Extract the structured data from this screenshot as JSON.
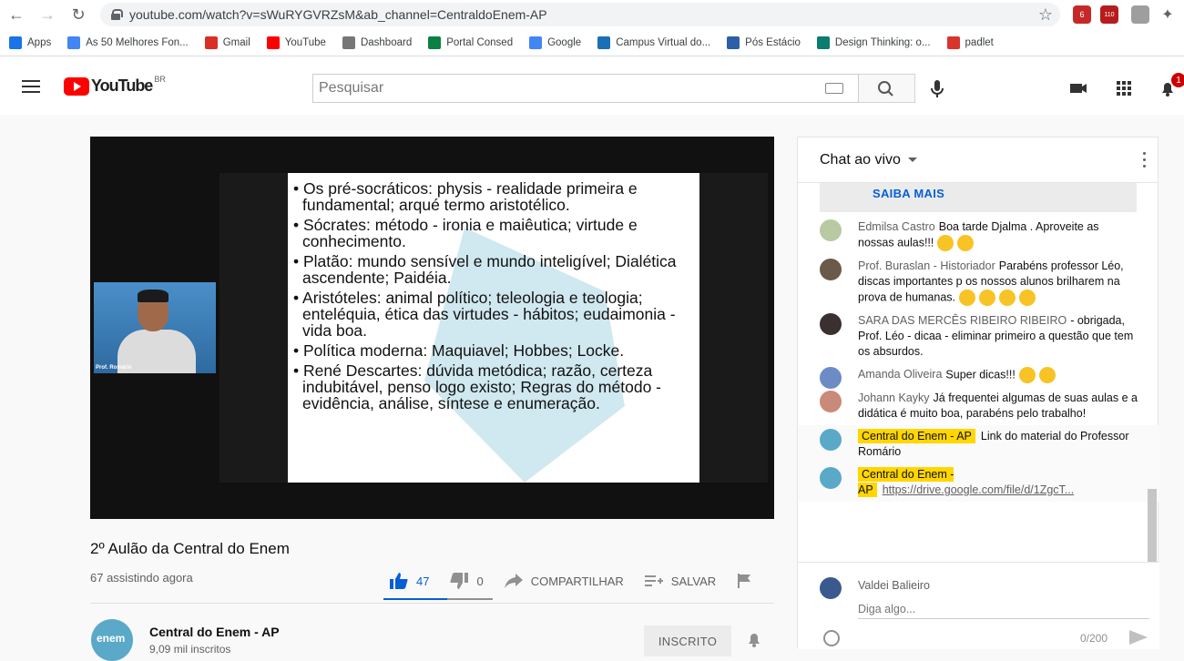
{
  "browser": {
    "url": "youtube.com/watch?v=sWuRYGVRZsM&ab_channel=CentraldoEnem-AP",
    "ext_badge_1": "6",
    "ext_badge_2": "110",
    "bookmarks": [
      {
        "label": "Apps",
        "icon": "apps-grid-icon",
        "color": "#1a73e8"
      },
      {
        "label": "As 50 Melhores Fon...",
        "icon": "doc-icon",
        "color": "#4285f4"
      },
      {
        "label": "Gmail",
        "icon": "gmail-icon",
        "color": "#d93025"
      },
      {
        "label": "YouTube",
        "icon": "youtube-icon",
        "color": "#ff0000"
      },
      {
        "label": "Dashboard",
        "icon": "dashboard-icon",
        "color": "#777777"
      },
      {
        "label": "Portal Consed",
        "icon": "portal-icon",
        "color": "#0b8043"
      },
      {
        "label": "Google",
        "icon": "google-icon",
        "color": "#4285f4"
      },
      {
        "label": "Campus Virtual do...",
        "icon": "campus-icon",
        "color": "#1a6fb5"
      },
      {
        "label": "Pós Estácio",
        "icon": "estacio-icon",
        "color": "#2d5fa8"
      },
      {
        "label": "Design Thinking: o...",
        "icon": "design-icon",
        "color": "#0a7d6e"
      },
      {
        "label": "padlet",
        "icon": "padlet-icon",
        "color": "#d8342c"
      }
    ]
  },
  "masthead": {
    "logo_text": "YouTube",
    "country": "BR",
    "search_placeholder": "Pesquisar",
    "notification_count": "1"
  },
  "video": {
    "slide_items": [
      "Os pré-socráticos: physis - realidade primeira e fundamental; arqué termo aristotélico.",
      "Sócrates: método - ironia e  maiêutica; virtude e conhecimento.",
      "Platão: mundo sensível e mundo inteligível; Dialética ascendente; Paidéia.",
      "Aristóteles: animal político; teleologia e teologia; enteléquia, ética das virtudes - hábitos; eudaimonia - vida boa.",
      "Política moderna: Maquiavel; Hobbes; Locke.",
      "René Descartes: dúvida metódica; razão, certeza indubitável, penso logo existo; Regras do método - evidência,  análise, síntese e enumeração."
    ],
    "cam_label": "Prof. Romário",
    "title": "2º Aulão da Central do Enem",
    "views": "67 assistindo agora",
    "likes": "47",
    "dislikes": "0",
    "like_ratio": 1.0,
    "share_label": "COMPARTILHAR",
    "save_label": "SALVAR",
    "channel_name": "Central do Enem - AP",
    "channel_subs": "9,09 mil inscritos",
    "channel_logo_text": "enem",
    "subscribe_label": "INSCRITO"
  },
  "chat": {
    "title": "Chat ao vivo",
    "banner_link": "SAIBA MAIS",
    "messages": [
      {
        "author": "Edmilsa Castro",
        "text": "Boa tarde Djalma . Aproveite as nossas aulas!!!",
        "emoji": 2,
        "avatar_color": "#b9c9a3"
      },
      {
        "author": "Prof. Buraslan - Historiador",
        "text": "Parabéns professor Léo, discas importantes p os nossos alunos brilharem na prova de humanas.",
        "emoji": 4,
        "avatar_color": "#6b5a4a"
      },
      {
        "author": "SARA DAS MERCÊS RIBEIRO RIBEIRO",
        "text": "- obrigada, Prof. Léo - dicaa - eliminar primeiro a questão que tem os absurdos.",
        "emoji": 0,
        "avatar_color": "#3a3030"
      },
      {
        "author": "Amanda Oliveira",
        "text": "Super dicas!!!",
        "emoji": 2,
        "avatar_color": "#6d8bc4"
      },
      {
        "author": "Johann Kayky",
        "text": "Já frequentei algumas de suas aulas e a didática é muito boa, parabéns pelo trabalho!",
        "emoji": 0,
        "avatar_color": "#c98a7a"
      }
    ],
    "owner_messages": [
      {
        "author": "Central do Enem - AP",
        "text": "Link do material do Professor Romário",
        "is_link": false
      },
      {
        "author": "Central do Enem - AP",
        "text": "https://drive.google.com/file/d/1ZgcT...",
        "is_link": true
      }
    ],
    "input_user": "Valdei Balieiro",
    "input_placeholder": "Diga algo...",
    "char_count": "0/200"
  }
}
